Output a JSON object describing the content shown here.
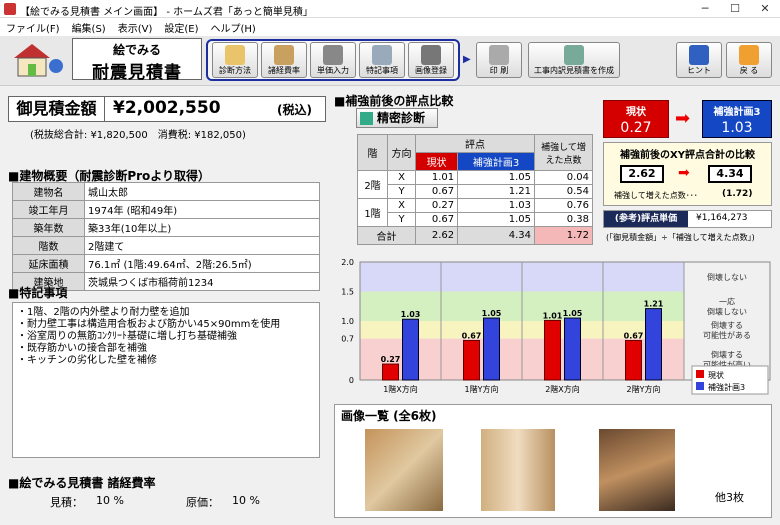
{
  "window": {
    "title": "【絵でみる見積書 メイン画面】 - ホームズ君「あっと簡単見積」"
  },
  "menu": [
    "ファイル(F)",
    "編集(S)",
    "表示(V)",
    "設定(E)",
    "ヘルプ(H)"
  ],
  "app": {
    "logo_line1": "絵でみる",
    "logo_line2": "耐震見積書"
  },
  "toolbar": {
    "buttons": [
      "診断方法",
      "諸経費率",
      "単価入力",
      "特記事項",
      "画像登録"
    ],
    "print": "印 刷",
    "create": "工事内訳見積書を作成",
    "hint": "ヒント",
    "back": "戻 る"
  },
  "estimate": {
    "label": "御見積金額",
    "amount": "¥2,002,550",
    "tax_note": "(税込)",
    "subtotal": "(税抜総合計: ¥1,820,500　消費税: ¥182,050)"
  },
  "building": {
    "title": "■建物概要（耐震診断Proより取得）",
    "rows": [
      [
        "建物名",
        "城山太郎"
      ],
      [
        "竣工年月",
        "1974年 (昭和49年)"
      ],
      [
        "築年数",
        "築33年(10年以上)"
      ],
      [
        "階数",
        "2階建て"
      ],
      [
        "延床面積",
        "76.1㎡ (1階:49.64㎡、2階:26.5㎡)"
      ],
      [
        "建築地",
        "茨城県つくば市稲荷前1234"
      ]
    ]
  },
  "notes": {
    "title": "■特記事項",
    "lines": [
      "・1階、2階の内外壁より耐力壁を追加",
      "・耐力壁工事は構造用合板および筋かい45×90mmを使用",
      "・浴室周りの無筋ｺﾝｸﾘｰﾄ基礎に増し打ち基礎補強",
      "・既存筋かいの接合部を補強",
      "・キッチンの劣化した壁を補修"
    ]
  },
  "expense": {
    "title": "■絵でみる見積書 諸経費率",
    "estimate_label": "見積：",
    "estimate_value": "10 %",
    "cost_label": "原価：",
    "cost_value": "10 %"
  },
  "compare": {
    "title": "■補強前後の評点比較",
    "diag_button": "精密診断",
    "col_floor": "階",
    "col_dir": "方向",
    "col_score": "評点",
    "col_before": "現状",
    "col_after": "補強計画3",
    "col_inc": "補強して増えた点数",
    "rows": [
      [
        "2階",
        "X",
        "1.01",
        "1.05",
        "0.04"
      ],
      [
        "",
        "Y",
        "0.67",
        "1.21",
        "0.54"
      ],
      [
        "1階",
        "X",
        "0.27",
        "1.03",
        "0.76"
      ],
      [
        "",
        "Y",
        "0.67",
        "1.05",
        "0.38"
      ]
    ],
    "total_label": "合計",
    "total": [
      "2.62",
      "4.34",
      "1.72"
    ]
  },
  "summary": {
    "before_label": "現状",
    "before": "0.27",
    "after_label": "補強計画3",
    "after": "1.03",
    "xy_title": "補強前後のXY評点合計の比較",
    "xy_before": "2.62",
    "xy_after": "4.34",
    "inc_label": "補強して増えた点数･･･",
    "inc": "(1.72)",
    "unit_label": "(参考)評点単価",
    "unit_value": "¥1,164,273",
    "unit_note": "(「御見積金額」÷「補強して増えた点数」)"
  },
  "chart_data": {
    "type": "bar",
    "categories": [
      "1階X方向",
      "1階Y方向",
      "2階X方向",
      "2階Y方向"
    ],
    "series": [
      {
        "name": "現状",
        "values": [
          0.27,
          0.67,
          1.01,
          0.67
        ]
      },
      {
        "name": "補強計画3",
        "values": [
          1.03,
          1.05,
          1.05,
          1.21
        ]
      }
    ],
    "yticks": [
      "2.0",
      "1.5",
      "1.0",
      "0.7",
      "0"
    ],
    "zones": [
      "倒壊しない",
      "一応\n倒壊しない",
      "倒壊する\n可能性がある",
      "倒壊する\n可能性が高い"
    ],
    "ylim": [
      0,
      2.0
    ],
    "colors": {
      "before": "#e00000",
      "after": "#3344dd"
    }
  },
  "images": {
    "title": "画像一覧 (全6枚)",
    "more": "他3枚"
  }
}
